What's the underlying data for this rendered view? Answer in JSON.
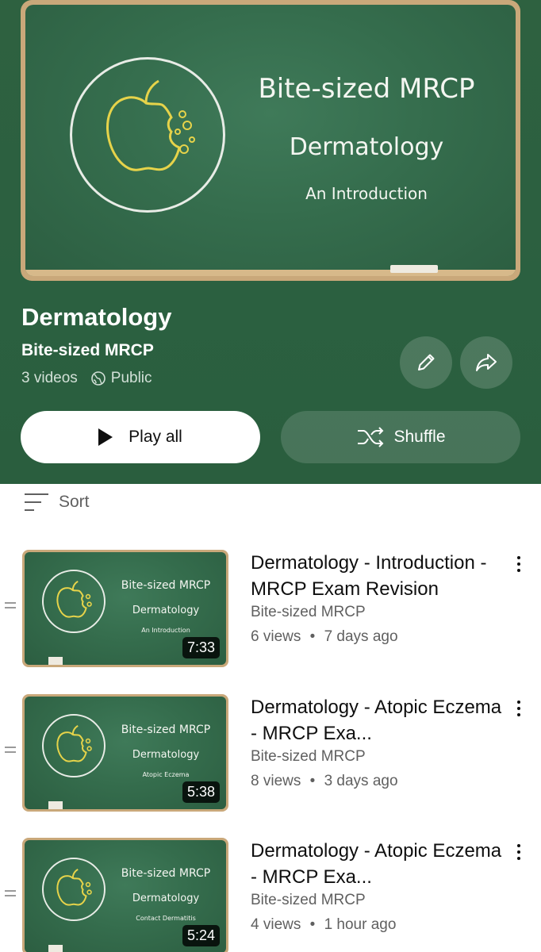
{
  "hero": {
    "line1": "Bite-sized MRCP",
    "line2": "Dermatology",
    "line3": "An Introduction"
  },
  "playlist": {
    "title": "Dermatology",
    "channel": "Bite-sized MRCP",
    "video_count": "3 videos",
    "visibility": "Public",
    "play_all_label": "Play all",
    "shuffle_label": "Shuffle"
  },
  "sort": {
    "label": "Sort"
  },
  "videos": [
    {
      "title": "Dermatology - Introduction - MRCP Exam Revision",
      "channel": "Bite-sized MRCP",
      "views": "6 views",
      "age": "7 days ago",
      "duration": "7:33",
      "thumb_line1": "Bite-sized MRCP",
      "thumb_line2": "Dermatology",
      "thumb_line3": "An Introduction"
    },
    {
      "title": "Dermatology - Atopic Eczema - MRCP Exa...",
      "channel": "Bite-sized MRCP",
      "views": "8 views",
      "age": "3 days ago",
      "duration": "5:38",
      "thumb_line1": "Bite-sized MRCP",
      "thumb_line2": "Dermatology",
      "thumb_line3": "Atopic Eczema"
    },
    {
      "title": "Dermatology - Atopic Eczema - MRCP Exa...",
      "channel": "Bite-sized MRCP",
      "views": "4 views",
      "age": "1 hour ago",
      "duration": "5:24",
      "thumb_line1": "Bite-sized MRCP",
      "thumb_line2": "Dermatology",
      "thumb_line3": "Contact Dermatitis"
    }
  ],
  "separator": "•",
  "icons": {
    "edit": "pencil-icon",
    "share": "share-arrow-icon",
    "play": "play-icon",
    "shuffle": "shuffle-icon",
    "sort": "sort-lines-icon",
    "visibility": "globe-icon",
    "more": "kebab-menu-icon",
    "drag": "drag-handle-icon"
  },
  "colors": {
    "header_green": "#2b6040",
    "chalkboard": "#356d4d",
    "chalk_yellow": "#e6d34a",
    "text_primary": "#0f0f0f",
    "text_secondary": "#606060"
  }
}
